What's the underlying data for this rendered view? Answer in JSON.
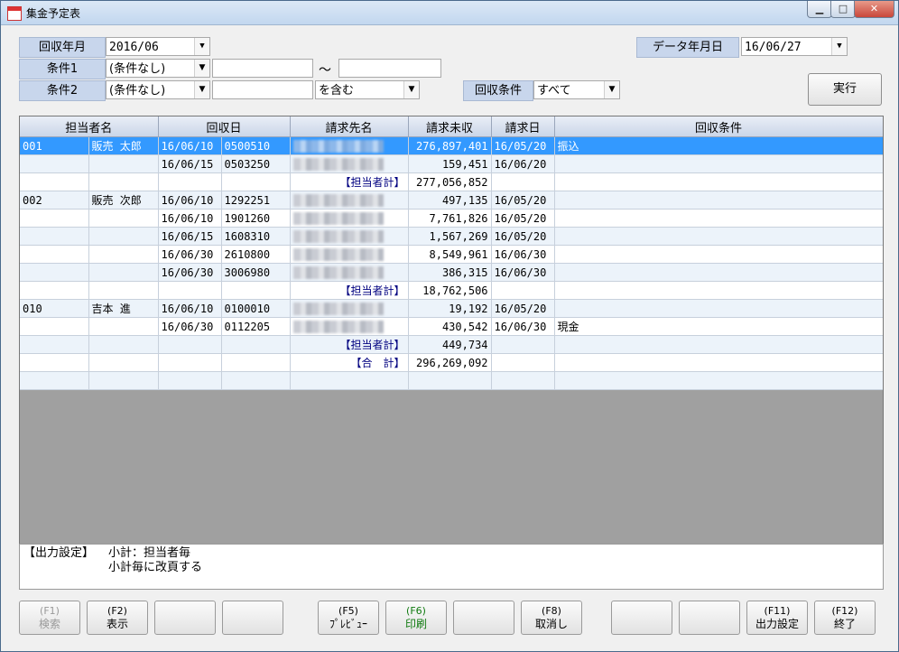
{
  "window": {
    "title": "集金予定表",
    "minimize_icon": "minimize-icon",
    "maximize_icon": "maximize-icon",
    "close_icon": "close-icon"
  },
  "filters": {
    "collect_month_label": "回収年月",
    "collect_month_value": "2016/06",
    "cond1_label": "条件1",
    "cond1_select": "(条件なし)",
    "cond1_from": "",
    "tilde": "～",
    "cond1_to": "",
    "cond2_label": "条件2",
    "cond2_select": "(条件なし)",
    "cond2_text": "",
    "cond2_match": "を含む",
    "collect_cond_label": "回収条件",
    "collect_cond_value": "すべて",
    "data_date_label": "データ年月日",
    "data_date_value": "16/06/27",
    "run_button": "実行"
  },
  "table": {
    "headers": [
      "担当者名",
      "",
      "回収日",
      "",
      "請求先名",
      "請求未収",
      "請求日",
      "回収条件"
    ],
    "rows": [
      {
        "code": "001",
        "name": "販売 太郎",
        "date": "16/06/10",
        "cust": "0500510",
        "blur": true,
        "amount": "276,897,401",
        "bill": "16/05/20",
        "cond": "振込",
        "sel": true
      },
      {
        "code": "",
        "name": "",
        "date": "16/06/15",
        "cust": "0503250",
        "blur": true,
        "amount": "159,451",
        "bill": "16/06/20",
        "cond": ""
      },
      {
        "code": "",
        "name": "",
        "date": "",
        "cust": "",
        "label": "【担当者計】",
        "amount": "277,056,852",
        "bill": "",
        "cond": ""
      },
      {
        "code": "002",
        "name": "販売 次郎",
        "date": "16/06/10",
        "cust": "1292251",
        "blur": true,
        "amount": "497,135",
        "bill": "16/05/20",
        "cond": ""
      },
      {
        "code": "",
        "name": "",
        "date": "16/06/10",
        "cust": "1901260",
        "blur": true,
        "amount": "7,761,826",
        "bill": "16/05/20",
        "cond": ""
      },
      {
        "code": "",
        "name": "",
        "date": "16/06/15",
        "cust": "1608310",
        "blur": true,
        "amount": "1,567,269",
        "bill": "16/05/20",
        "cond": ""
      },
      {
        "code": "",
        "name": "",
        "date": "16/06/30",
        "cust": "2610800",
        "blur": true,
        "amount": "8,549,961",
        "bill": "16/06/30",
        "cond": ""
      },
      {
        "code": "",
        "name": "",
        "date": "16/06/30",
        "cust": "3006980",
        "blur": true,
        "amount": "386,315",
        "bill": "16/06/30",
        "cond": ""
      },
      {
        "code": "",
        "name": "",
        "date": "",
        "cust": "",
        "label": "【担当者計】",
        "amount": "18,762,506",
        "bill": "",
        "cond": ""
      },
      {
        "code": "010",
        "name": "吉本 進",
        "date": "16/06/10",
        "cust": "0100010",
        "blur": true,
        "amount": "19,192",
        "bill": "16/05/20",
        "cond": ""
      },
      {
        "code": "",
        "name": "",
        "date": "16/06/30",
        "cust": "0112205",
        "blur": true,
        "amount": "430,542",
        "bill": "16/06/30",
        "cond": "現金"
      },
      {
        "code": "",
        "name": "",
        "date": "",
        "cust": "",
        "label": "【担当者計】",
        "amount": "449,734",
        "bill": "",
        "cond": ""
      },
      {
        "code": "",
        "name": "",
        "date": "",
        "cust": "",
        "label": "【合　計】",
        "amount": "296,269,092",
        "bill": "",
        "cond": ""
      },
      {
        "code": "",
        "name": "",
        "date": "",
        "cust": "",
        "amount": "",
        "bill": "",
        "cond": ""
      }
    ]
  },
  "note": {
    "label": "【出力設定】",
    "line1": "小計：担当者毎",
    "line2": "小計毎に改頁する"
  },
  "fkeys": [
    {
      "key": "(F1)",
      "label": "検索",
      "state": "dis"
    },
    {
      "key": "(F2)",
      "label": "表示",
      "state": ""
    },
    {
      "key": "",
      "label": "",
      "state": ""
    },
    {
      "key": "",
      "label": "",
      "state": ""
    },
    {
      "key": "(F5)",
      "label": "ﾌﾟﾚﾋﾞｭｰ",
      "state": ""
    },
    {
      "key": "(F6)",
      "label": "印刷",
      "state": "grn"
    },
    {
      "key": "",
      "label": "",
      "state": ""
    },
    {
      "key": "(F8)",
      "label": "取消し",
      "state": ""
    },
    {
      "key": "",
      "label": "",
      "state": ""
    },
    {
      "key": "",
      "label": "",
      "state": ""
    },
    {
      "key": "(F11)",
      "label": "出力設定",
      "state": ""
    },
    {
      "key": "(F12)",
      "label": "終了",
      "state": ""
    }
  ]
}
